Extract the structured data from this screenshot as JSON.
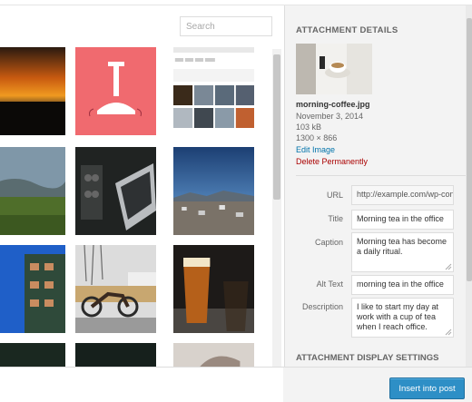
{
  "search": {
    "placeholder": "Search"
  },
  "details": {
    "heading": "ATTACHMENT DETAILS",
    "filename": "morning-coffee.jpg",
    "date": "November 3, 2014",
    "size": "103 kB",
    "dimensions": "1300 × 866",
    "edit_label": "Edit Image",
    "delete_label": "Delete Permanently"
  },
  "fields": {
    "url_label": "URL",
    "url_value": "http://example.com/wp-content",
    "title_label": "Title",
    "title_value": "Morning tea in the office",
    "caption_label": "Caption",
    "caption_value": "Morning tea has become a daily ritual.",
    "alt_label": "Alt Text",
    "alt_value": "morning tea in the office",
    "description_label": "Description",
    "description_value": "I like to start my day at work with a cup of tea when I reach office."
  },
  "display_settings_heading": "ATTACHMENT DISPLAY SETTINGS",
  "footer": {
    "insert_label": "Insert into post"
  },
  "colors": {
    "primary_button": "#2e8fc6",
    "delete_link": "#aa0000",
    "link": "#0073aa"
  },
  "thumbnails": [
    "sunset-clouds",
    "pink-lamp-illustration",
    "screenshot-grid",
    "mountain-landscape",
    "laptop-desk",
    "city-skyline",
    "blue-building",
    "motorcycle-street",
    "glass-of-beer",
    "dark-photo",
    "dark-photo-2",
    "hand-photo"
  ]
}
